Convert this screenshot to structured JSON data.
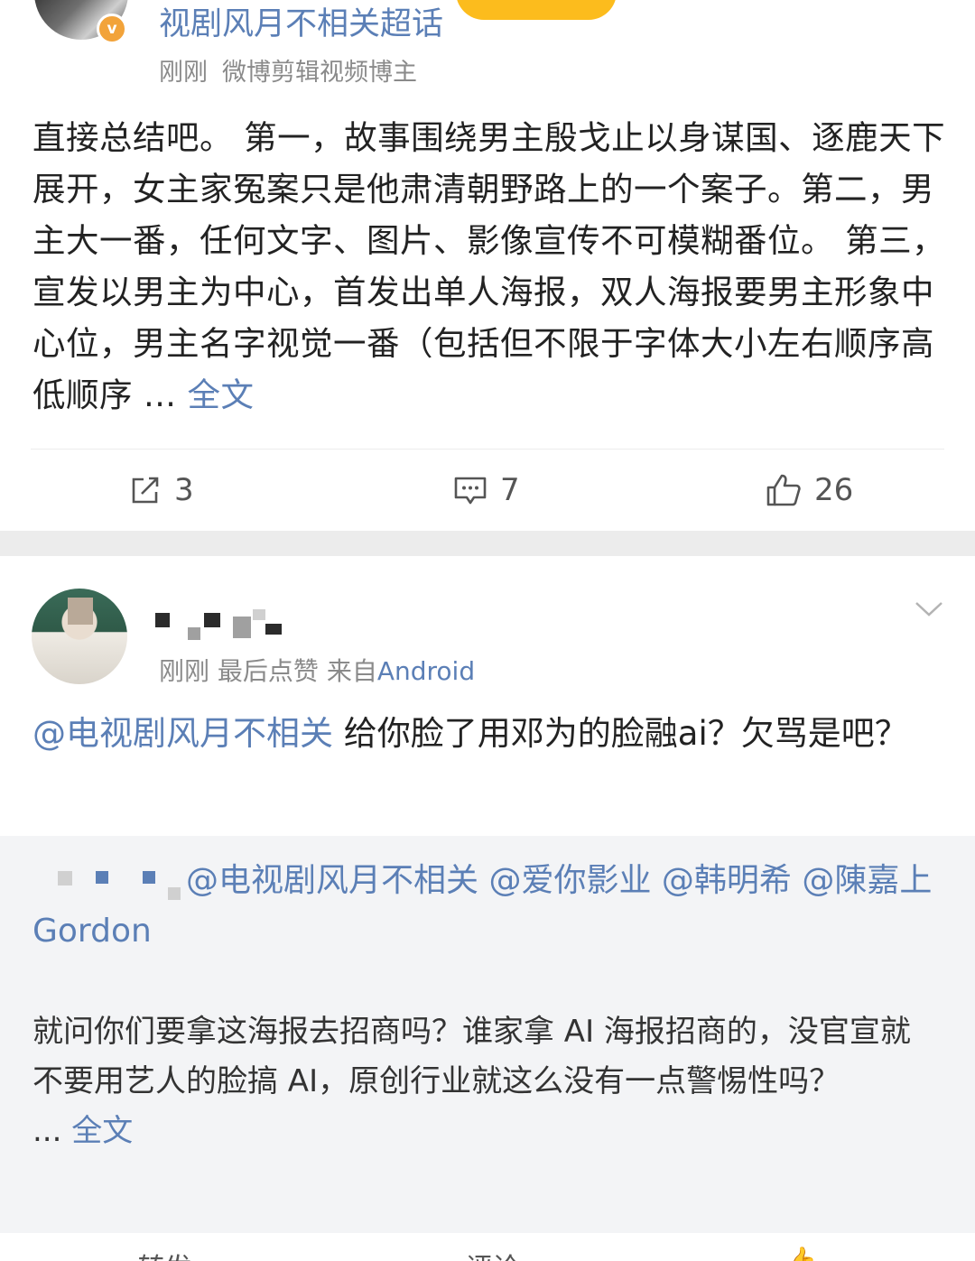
{
  "post1": {
    "account_name": "视剧风月不相关超话",
    "badge": "v",
    "time": "刚刚",
    "account_desc": "微博剪辑视频博主",
    "text": "直接总结吧。 第一，故事围绕男主殷戈止以身谋国、逐鹿天下展开，女主家冤案只是他肃清朝野路上的一个案子。第二，男主大一番，任何文字、图片、影像宣传不可模糊番位。 第三，宣发以男主为中心，首发出单人海报，双人海报要男主形象中心位，男主名字视觉一番（包括但不限于字体大小左右顺序高低顺序 ...",
    "more": "全文",
    "actions": {
      "repost_count": "3",
      "comment_count": "7",
      "like_count": "26"
    }
  },
  "post2": {
    "time": "刚刚",
    "tag": "最后点赞",
    "source_prefix": "来自",
    "source": "Android",
    "mention": "@电视剧风月不相关",
    "text": "给你脸了用邓为的脸融ai？欠骂是吧？"
  },
  "quote": {
    "mentions": "@电视剧风月不相关 @爱你影业 @韩明希 @陳嘉上 Gordon",
    "text": "就问你们要拿这海报去招商吗？谁家拿 AI 海报招商的，没官宣就不要用艺人的脸搞 AI，原创行业就这么没有一点警惕性吗？",
    "more_prefix": "...",
    "more": "全文"
  },
  "bottom_bar": {
    "repost": "转发",
    "comment": "评论"
  },
  "colors": {
    "link": "#5b7fb6",
    "badge": "#f2a33a",
    "pill": "#fcbc1d",
    "band": "#ececec"
  }
}
